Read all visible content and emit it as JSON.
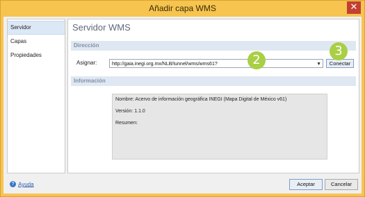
{
  "window": {
    "title": "Añadir capa WMS",
    "close_glyph": "✕"
  },
  "nav": {
    "items": [
      "Servidor",
      "Capas",
      "Propiedades"
    ]
  },
  "panel": {
    "title": "Servidor WMS",
    "direccion_section": "Dirección",
    "asignar_label": "Asignar:",
    "url_value": "http://gaia.inegi.org.mx/NLB/tunnel/wms/wms61?",
    "conectar_label": "Conectar",
    "informacion_section": "Información",
    "info": {
      "nombre": "Nombre: Acervo de información geográfica INEGI (Mapa Digital de México v61)",
      "version": "Versión: 1.1.0",
      "resumen": "Resumen:"
    }
  },
  "badges": {
    "two": "2",
    "three": "3"
  },
  "footer": {
    "help_label": "Ayuda",
    "aceptar_label": "Aceptar",
    "cancelar_label": "Cancelar"
  },
  "icons": {
    "help": "help-icon",
    "dropdown": "chevron-down-icon",
    "close": "close-icon"
  },
  "colors": {
    "title_bar": "#f6c44f",
    "badge": "#a9cf45",
    "section": "#dfe8f2"
  }
}
